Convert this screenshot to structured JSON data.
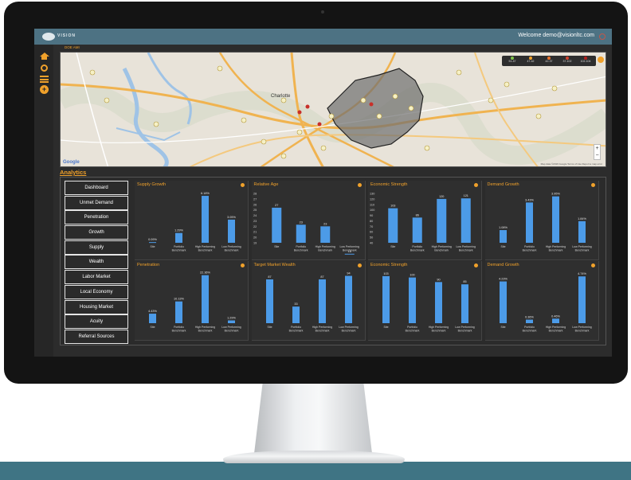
{
  "header": {
    "logo_text": "VISION",
    "welcome_text": "Welcome demo@visionltc.com"
  },
  "nav": {
    "icons": [
      "home-icon",
      "target-icon",
      "list-icon",
      "plus-icon"
    ]
  },
  "map": {
    "title": "DOE AMI",
    "city_label": "Charlotte",
    "google_label": "Google",
    "credit_text": "Map data ©2016 Google  Terms of Use  Report a map error",
    "legend": [
      {
        "label": "51-47",
        "color": "#7fc44a"
      },
      {
        "label": "47-42",
        "color": "#f0a12b"
      },
      {
        "label": "42-37",
        "color": "#e8722b"
      },
      {
        "label": "37-102",
        "color": "#d2422d"
      },
      {
        "label": "102-104",
        "color": "#b3201c"
      }
    ],
    "zoom_in": "+",
    "zoom_out": "−"
  },
  "analytics": {
    "title": "Analytics",
    "menu": [
      "Dashboard",
      "Unmet Demand",
      "Penetration",
      "Growth",
      "Supply",
      "Wealth",
      "Labor Market",
      "Local Economy",
      "Housing Market",
      "Acuity",
      "Referral Sources"
    ]
  },
  "charts": [
    {
      "title": "Supply Growth",
      "categories": [
        "Site",
        "Portfolio Benchmark",
        "High Performing Benchmark",
        "Low Performing Benchmark"
      ],
      "values": [
        0.09,
        1.29,
        6.18,
        3.05
      ],
      "labels": [
        "0.09%",
        "1.29%",
        "6.18%",
        "3.05%"
      ],
      "yticks": [],
      "ymax": 6.5
    },
    {
      "title": "Relative Age",
      "categories": [
        "Site",
        "Portfolio Benchmark",
        "High Performing Benchmark",
        "Low Performing Benchmark"
      ],
      "values": [
        25.4,
        22.3,
        22.0,
        17.0
      ],
      "labels": [
        "27",
        "23",
        "23",
        "18"
      ],
      "yticks": [
        "28",
        "27",
        "26",
        "25",
        "24",
        "23",
        "22",
        "21",
        "20",
        "19"
      ],
      "ymax": 28
    },
    {
      "title": "Economic Strength",
      "categories": [
        "Site",
        "Portfolio Benchmark",
        "High Performing Benchmark",
        "Low Performing Benchmark"
      ],
      "values": [
        103,
        86,
        120,
        121
      ],
      "labels": [
        "103",
        "86",
        "120",
        "121"
      ],
      "yticks": [
        "130",
        "120",
        "110",
        "100",
        "90",
        "80",
        "70",
        "60",
        "50",
        "40"
      ],
      "ymax": 130,
      "ymin": 40
    },
    {
      "title": "Demand Growth",
      "categories": [
        "Site",
        "Portfolio Benchmark",
        "High Performing Benchmark",
        "Low Performing Benchmark"
      ],
      "values": [
        1.08,
        3.43,
        3.95,
        1.84
      ],
      "labels": [
        "1.08%",
        "3.43%",
        "3.95%",
        "1.84%"
      ],
      "yticks": [],
      "ymax": 4.2
    },
    {
      "title": "Penetration",
      "categories": [
        "Site",
        "Portfolio Benchmark",
        "High Performing Benchmark",
        "Low Performing Benchmark"
      ],
      "values": [
        4.43,
        10.13,
        22.36,
        1.29
      ],
      "labels": [
        "4.43%",
        "10.13%",
        "22.36%",
        "1.29%"
      ],
      "yticks": [],
      "ymax": 23
    },
    {
      "title": "Target Market Wealth",
      "categories": [
        "Site",
        "Portfolio Benchmark",
        "High Performing Benchmark",
        "Low Performing Benchmark"
      ],
      "values": [
        87,
        33,
        87,
        94
      ],
      "labels": [
        "87",
        "33",
        "87",
        "94"
      ],
      "yticks": [],
      "ymax": 98
    },
    {
      "title": "Economic Strength",
      "categories": [
        "Site",
        "Portfolio Benchmark",
        "High Performing Benchmark",
        "Low Performing Benchmark"
      ],
      "values": [
        103,
        100,
        90,
        85
      ],
      "labels": [
        "103",
        "100",
        "90",
        "85"
      ],
      "yticks": [],
      "ymax": 108
    },
    {
      "title": "Demand Growth",
      "categories": [
        "Site",
        "Portfolio Benchmark",
        "High Performing Benchmark",
        "Low Performing Benchmark"
      ],
      "values": [
        4.23,
        0.36,
        0.46,
        4.74
      ],
      "labels": [
        "4.23%",
        "0.36%",
        "0.46%",
        "4.74%"
      ],
      "yticks": [],
      "ymax": 5
    }
  ]
}
